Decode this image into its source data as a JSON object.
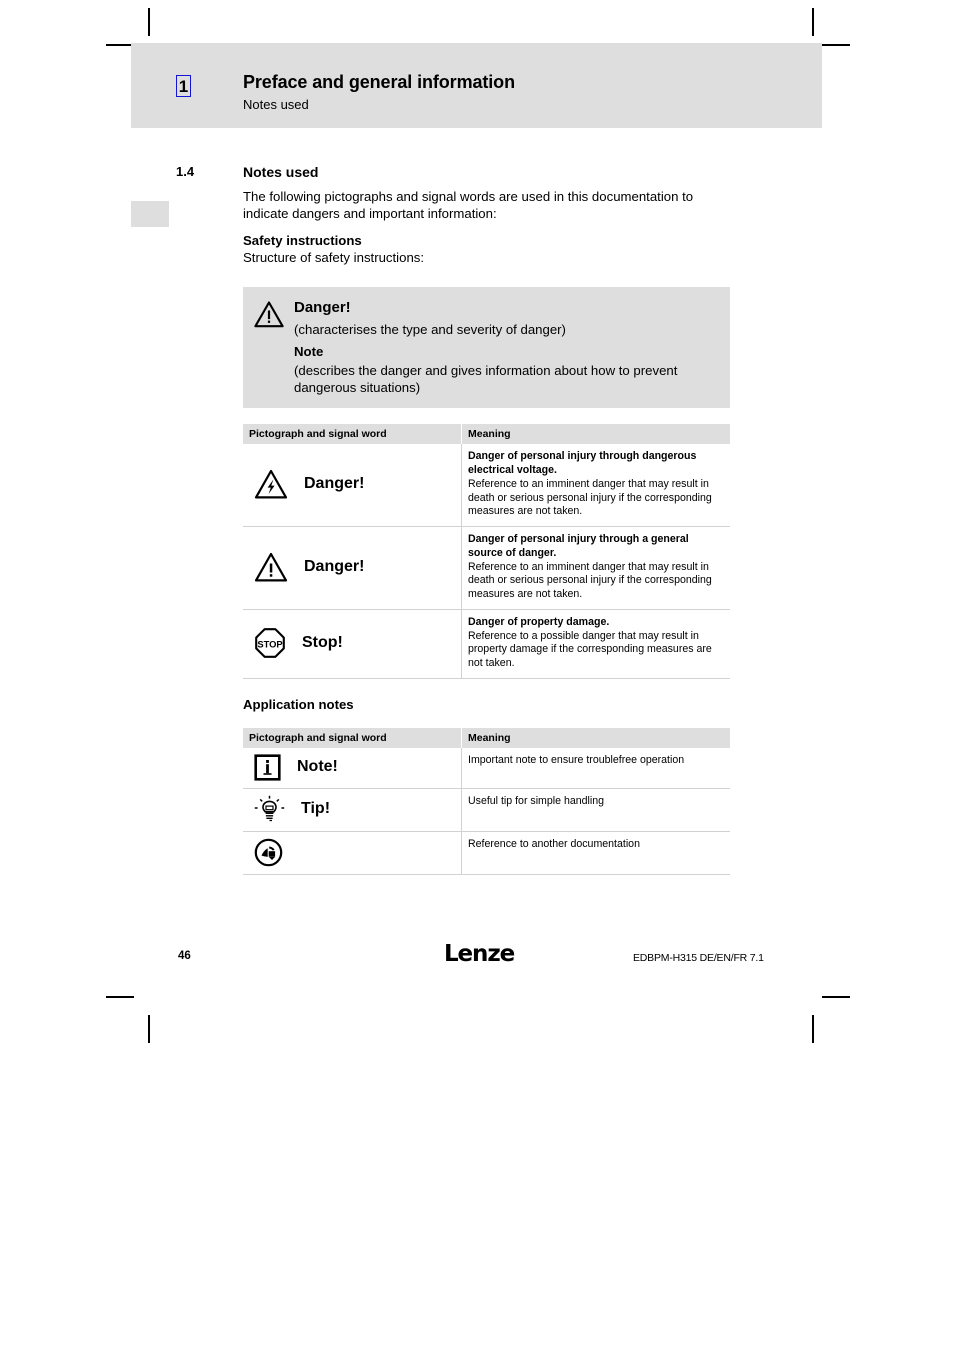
{
  "page": {
    "chapter_number": "1",
    "header_title": "Preface and general information",
    "header_subtitle": "Notes used",
    "section_number": "1.4",
    "section_title": "Notes used",
    "intro_paragraph": "The following pictographs and signal words are used in this documentation to indicate dangers and important information:",
    "safety_heading": "Safety instructions",
    "safety_structure_line": "Structure of safety instructions:",
    "application_notes_heading": "Application notes"
  },
  "callout": {
    "icon": "warning-triangle-icon",
    "title": "Danger!",
    "line1": "(characterises the type and severity of danger)",
    "note_label": "Note",
    "line2": "(describes the danger and gives information about how to prevent dangerous situations)"
  },
  "safety_table": {
    "headers": {
      "signal": "Pictograph and signal word",
      "meaning": "Meaning"
    },
    "rows": [
      {
        "icon": "electrical-danger-triangle-icon",
        "signal_word": "Danger!",
        "meaning_bold": "Danger of personal injury through dangerous electrical voltage.",
        "meaning_text": "Reference to an imminent danger that may result in death or serious personal injury if the corresponding measures are not taken."
      },
      {
        "icon": "general-danger-triangle-icon",
        "signal_word": "Danger!",
        "meaning_bold": "Danger of personal injury through a general source of danger.",
        "meaning_text": "Reference to an imminent danger that may result in death or serious personal injury if the corresponding measures are not taken."
      },
      {
        "icon": "stop-octagon-icon",
        "signal_word": "Stop!",
        "meaning_bold": "Danger of property damage.",
        "meaning_text": "Reference to a possible danger that may result in property damage if the corresponding measures are not taken."
      }
    ]
  },
  "application_table": {
    "headers": {
      "signal": "Pictograph and signal word",
      "meaning": "Meaning"
    },
    "rows": [
      {
        "icon": "info-square-icon",
        "signal_word": "Note!",
        "meaning_text": "Important note to ensure troublefree operation"
      },
      {
        "icon": "lightbulb-tip-icon",
        "signal_word": "Tip!",
        "meaning_text": "Useful tip for simple handling"
      },
      {
        "icon": "read-documentation-circle-icon",
        "signal_word": "",
        "meaning_text": "Reference to another documentation"
      }
    ]
  },
  "footer": {
    "page_number": "46",
    "logo_text": "Lenze",
    "document_id": "EDBPM-H315 DE/EN/FR 7.1"
  },
  "colors": {
    "band_gray": "#dededf",
    "rule_gray": "#d2d2d2",
    "link_blue": "#1414d4"
  }
}
